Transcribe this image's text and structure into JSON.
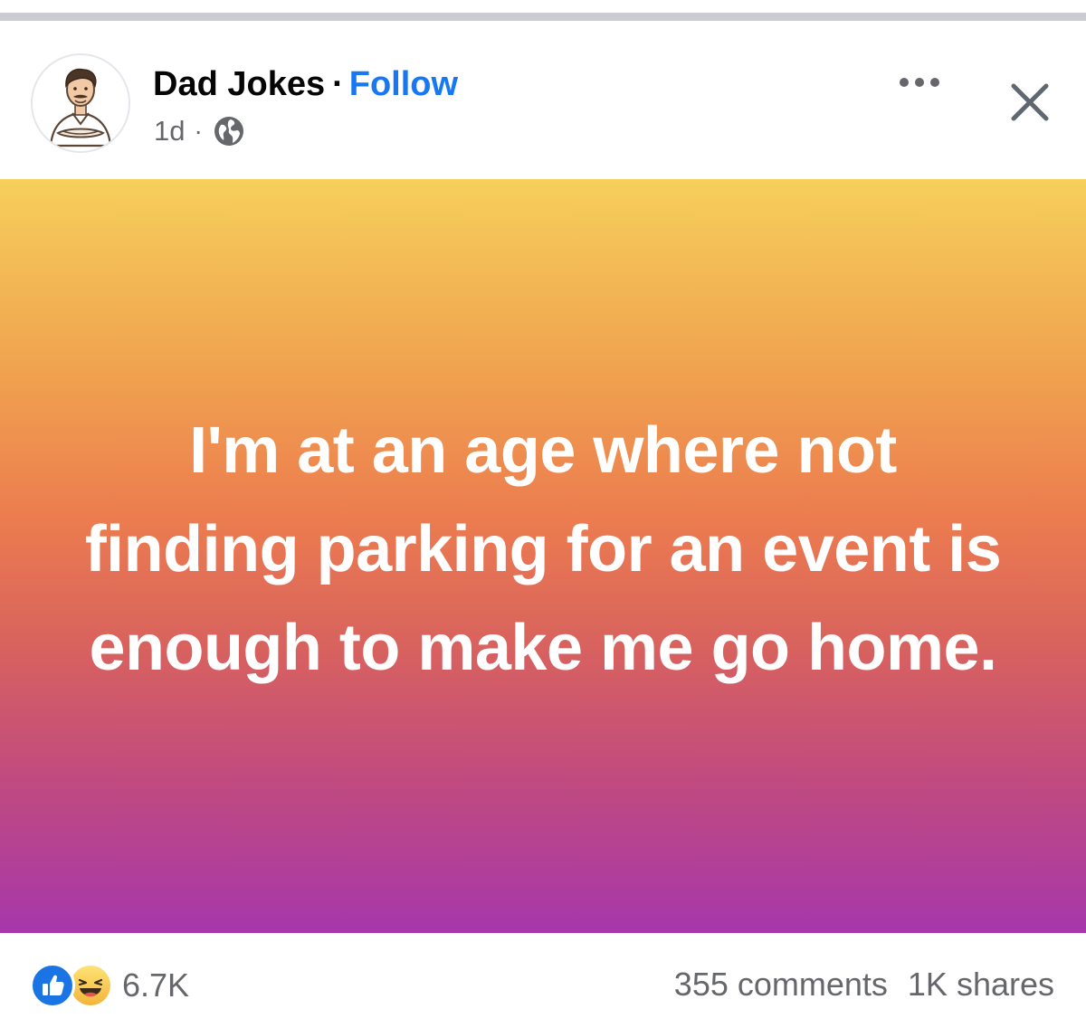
{
  "post": {
    "page_name": "Dad Jokes",
    "separator": "·",
    "follow_label": "Follow",
    "timestamp": "1d",
    "meta_separator": "·",
    "audience_icon": "globe-icon",
    "more_icon": "more-horizontal-icon",
    "close_icon": "close-icon",
    "avatar_icon": "cartoon-man-avatar",
    "text": "I'm at an age where not finding parking for an event is enough to make me go home.",
    "background_colors": [
      "#f6cf5b",
      "#ec7c4f",
      "#a637ab"
    ]
  },
  "footer": {
    "reaction_icons": [
      "like-icon",
      "haha-icon"
    ],
    "reaction_count": "6.7K",
    "comments": "355 comments",
    "shares": "1K shares"
  },
  "colors": {
    "link_blue": "#1877f2",
    "secondary_text": "#65676b",
    "primary_text": "#050505",
    "like_blue": "#1b74e4",
    "haha_yellow": "#f7c948"
  }
}
